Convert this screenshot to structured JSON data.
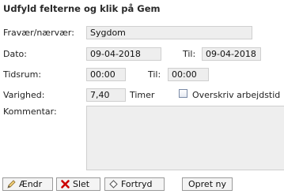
{
  "form": {
    "title": "Udfyld felterne og klik på Gem",
    "absence_label": "Fravær/nærvær:",
    "absence_value": "Sygdom",
    "date_label": "Dato:",
    "date_from": "09-04-2018",
    "date_to_label": "Til:",
    "date_to": "09-04-2018",
    "time_label": "Tidsrum:",
    "time_from": "00:00",
    "time_to_label": "Til:",
    "time_to": "00:00",
    "duration_label": "Varighed:",
    "duration_value": "7,40",
    "duration_unit": "Timer",
    "overwrite_label": "Overskriv arbejdstid",
    "overwrite_checked": false,
    "comment_label": "Kommentar:"
  },
  "buttons": {
    "edit": "Ændr",
    "delete": "Slet",
    "undo": "Fortryd",
    "create_new": "Opret ny"
  },
  "icons": {
    "edit": "pencil-icon",
    "delete": "x-icon",
    "undo": "diamond-icon"
  },
  "colors": {
    "field_bg": "#eeeeee",
    "delete_icon": "#cc0000"
  }
}
